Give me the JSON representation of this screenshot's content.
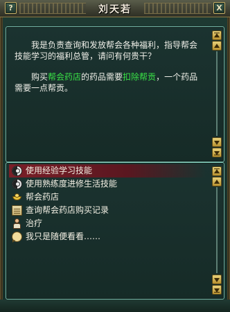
{
  "window": {
    "title": "刘天若",
    "help_label": "?",
    "close_label": "X"
  },
  "dialog": {
    "paragraph1": "我是负责查询和发放帮会各种福利，指导帮会技能学习的福利总管，请问有何贵干？",
    "p2_part1": "购买",
    "p2_highlight1": "帮会药店",
    "p2_part2": "的药品需要",
    "p2_highlight2": "扣除帮贡",
    "p2_part3": "，一个药品需要一点帮贡。"
  },
  "options": [
    {
      "label": "使用经验学习技能",
      "icon": "yin-yang-icon"
    },
    {
      "label": "使用熟练度进修生活技能",
      "icon": "yin-yang-icon"
    },
    {
      "label": "帮会药店",
      "icon": "gold-ingot-icon"
    },
    {
      "label": "查询帮会药店购买记录",
      "icon": "scroll-icon"
    },
    {
      "label": "治疗",
      "icon": "healer-icon"
    },
    {
      "label": "我只是随便看看……",
      "icon": "speech-bubble-icon"
    }
  ],
  "colors": {
    "highlight": "#39e046",
    "selected_row": "#7a1f28",
    "panel_border": "#76b7a8"
  }
}
